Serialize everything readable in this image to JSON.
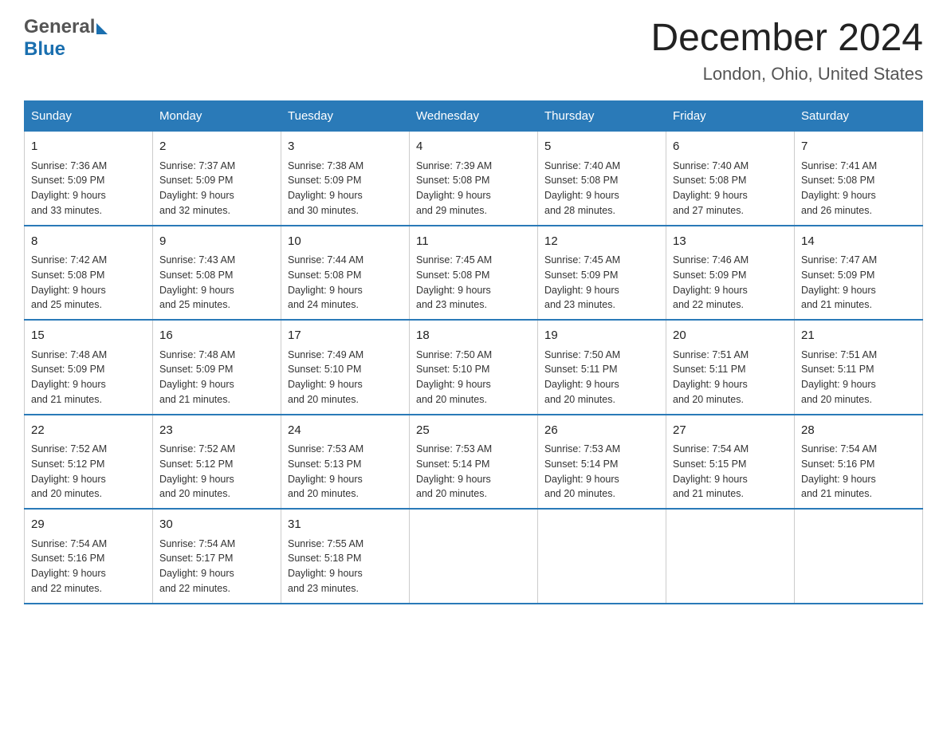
{
  "header": {
    "logo_general": "General",
    "logo_blue": "Blue",
    "title": "December 2024",
    "subtitle": "London, Ohio, United States"
  },
  "days_of_week": [
    "Sunday",
    "Monday",
    "Tuesday",
    "Wednesday",
    "Thursday",
    "Friday",
    "Saturday"
  ],
  "weeks": [
    [
      {
        "day": "1",
        "sunrise": "7:36 AM",
        "sunset": "5:09 PM",
        "daylight": "9 hours and 33 minutes."
      },
      {
        "day": "2",
        "sunrise": "7:37 AM",
        "sunset": "5:09 PM",
        "daylight": "9 hours and 32 minutes."
      },
      {
        "day": "3",
        "sunrise": "7:38 AM",
        "sunset": "5:09 PM",
        "daylight": "9 hours and 30 minutes."
      },
      {
        "day": "4",
        "sunrise": "7:39 AM",
        "sunset": "5:08 PM",
        "daylight": "9 hours and 29 minutes."
      },
      {
        "day": "5",
        "sunrise": "7:40 AM",
        "sunset": "5:08 PM",
        "daylight": "9 hours and 28 minutes."
      },
      {
        "day": "6",
        "sunrise": "7:40 AM",
        "sunset": "5:08 PM",
        "daylight": "9 hours and 27 minutes."
      },
      {
        "day": "7",
        "sunrise": "7:41 AM",
        "sunset": "5:08 PM",
        "daylight": "9 hours and 26 minutes."
      }
    ],
    [
      {
        "day": "8",
        "sunrise": "7:42 AM",
        "sunset": "5:08 PM",
        "daylight": "9 hours and 25 minutes."
      },
      {
        "day": "9",
        "sunrise": "7:43 AM",
        "sunset": "5:08 PM",
        "daylight": "9 hours and 25 minutes."
      },
      {
        "day": "10",
        "sunrise": "7:44 AM",
        "sunset": "5:08 PM",
        "daylight": "9 hours and 24 minutes."
      },
      {
        "day": "11",
        "sunrise": "7:45 AM",
        "sunset": "5:08 PM",
        "daylight": "9 hours and 23 minutes."
      },
      {
        "day": "12",
        "sunrise": "7:45 AM",
        "sunset": "5:09 PM",
        "daylight": "9 hours and 23 minutes."
      },
      {
        "day": "13",
        "sunrise": "7:46 AM",
        "sunset": "5:09 PM",
        "daylight": "9 hours and 22 minutes."
      },
      {
        "day": "14",
        "sunrise": "7:47 AM",
        "sunset": "5:09 PM",
        "daylight": "9 hours and 21 minutes."
      }
    ],
    [
      {
        "day": "15",
        "sunrise": "7:48 AM",
        "sunset": "5:09 PM",
        "daylight": "9 hours and 21 minutes."
      },
      {
        "day": "16",
        "sunrise": "7:48 AM",
        "sunset": "5:09 PM",
        "daylight": "9 hours and 21 minutes."
      },
      {
        "day": "17",
        "sunrise": "7:49 AM",
        "sunset": "5:10 PM",
        "daylight": "9 hours and 20 minutes."
      },
      {
        "day": "18",
        "sunrise": "7:50 AM",
        "sunset": "5:10 PM",
        "daylight": "9 hours and 20 minutes."
      },
      {
        "day": "19",
        "sunrise": "7:50 AM",
        "sunset": "5:11 PM",
        "daylight": "9 hours and 20 minutes."
      },
      {
        "day": "20",
        "sunrise": "7:51 AM",
        "sunset": "5:11 PM",
        "daylight": "9 hours and 20 minutes."
      },
      {
        "day": "21",
        "sunrise": "7:51 AM",
        "sunset": "5:11 PM",
        "daylight": "9 hours and 20 minutes."
      }
    ],
    [
      {
        "day": "22",
        "sunrise": "7:52 AM",
        "sunset": "5:12 PM",
        "daylight": "9 hours and 20 minutes."
      },
      {
        "day": "23",
        "sunrise": "7:52 AM",
        "sunset": "5:12 PM",
        "daylight": "9 hours and 20 minutes."
      },
      {
        "day": "24",
        "sunrise": "7:53 AM",
        "sunset": "5:13 PM",
        "daylight": "9 hours and 20 minutes."
      },
      {
        "day": "25",
        "sunrise": "7:53 AM",
        "sunset": "5:14 PM",
        "daylight": "9 hours and 20 minutes."
      },
      {
        "day": "26",
        "sunrise": "7:53 AM",
        "sunset": "5:14 PM",
        "daylight": "9 hours and 20 minutes."
      },
      {
        "day": "27",
        "sunrise": "7:54 AM",
        "sunset": "5:15 PM",
        "daylight": "9 hours and 21 minutes."
      },
      {
        "day": "28",
        "sunrise": "7:54 AM",
        "sunset": "5:16 PM",
        "daylight": "9 hours and 21 minutes."
      }
    ],
    [
      {
        "day": "29",
        "sunrise": "7:54 AM",
        "sunset": "5:16 PM",
        "daylight": "9 hours and 22 minutes."
      },
      {
        "day": "30",
        "sunrise": "7:54 AM",
        "sunset": "5:17 PM",
        "daylight": "9 hours and 22 minutes."
      },
      {
        "day": "31",
        "sunrise": "7:55 AM",
        "sunset": "5:18 PM",
        "daylight": "9 hours and 23 minutes."
      },
      null,
      null,
      null,
      null
    ]
  ],
  "labels": {
    "sunrise": "Sunrise:",
    "sunset": "Sunset:",
    "daylight": "Daylight:"
  }
}
